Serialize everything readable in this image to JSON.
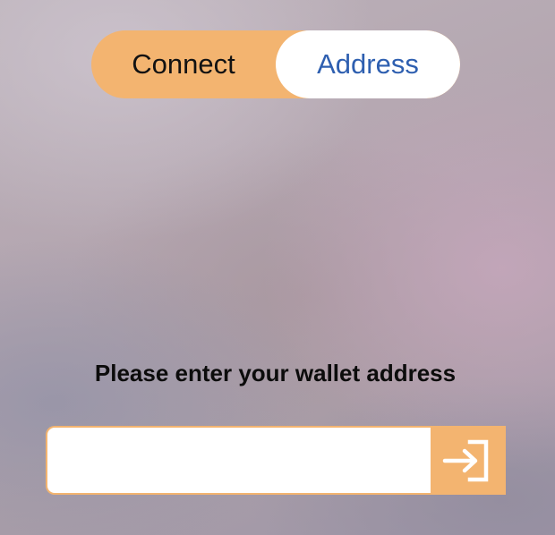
{
  "toggle": {
    "connect_label": "Connect",
    "address_label": "Address",
    "selected": "Address"
  },
  "prompt": {
    "text": "Please enter your wallet address"
  },
  "address_input": {
    "value": "",
    "placeholder": ""
  },
  "submit": {
    "icon": "login-arrow-icon"
  },
  "colors": {
    "accent": "#f3b470",
    "selected_text": "#2e5fb0",
    "text": "#121212"
  }
}
